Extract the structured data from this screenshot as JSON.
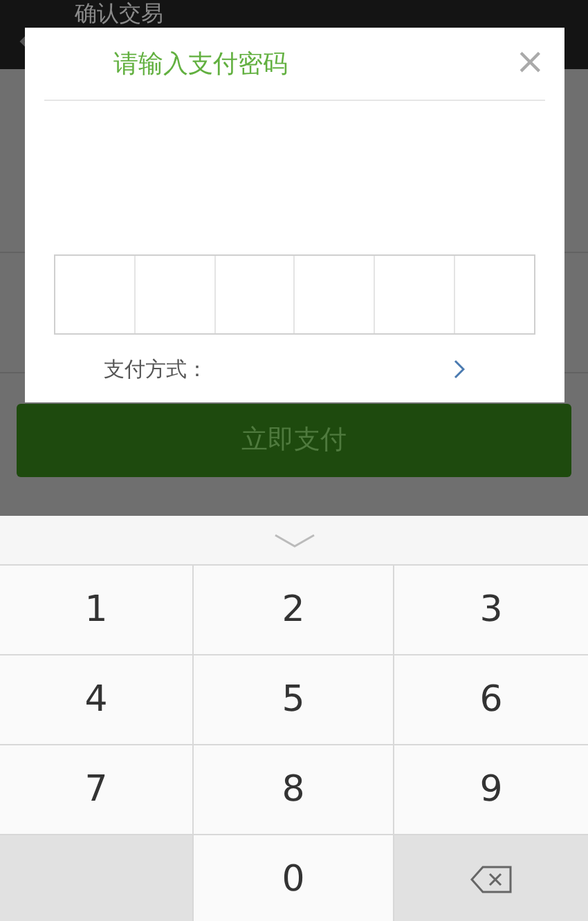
{
  "header": {
    "title": "确认交易"
  },
  "dialog": {
    "title": "请输入支付密码",
    "close": "×",
    "password_cells": [
      {
        "filled": false
      },
      {
        "filled": false
      },
      {
        "filled": false
      },
      {
        "filled": false
      },
      {
        "filled": false
      },
      {
        "filled": false
      }
    ],
    "payment_label": "支付方式："
  },
  "pay_button": {
    "label": "立即支付",
    "disabled": true
  },
  "keypad": {
    "keys": [
      {
        "kind": "digit",
        "label": "1"
      },
      {
        "kind": "digit",
        "label": "2"
      },
      {
        "kind": "digit",
        "label": "3"
      },
      {
        "kind": "digit",
        "label": "4"
      },
      {
        "kind": "digit",
        "label": "5"
      },
      {
        "kind": "digit",
        "label": "6"
      },
      {
        "kind": "digit",
        "label": "7"
      },
      {
        "kind": "digit",
        "label": "8"
      },
      {
        "kind": "digit",
        "label": "9"
      },
      {
        "kind": "blank"
      },
      {
        "kind": "digit",
        "label": "0"
      },
      {
        "kind": "backspace"
      }
    ]
  }
}
